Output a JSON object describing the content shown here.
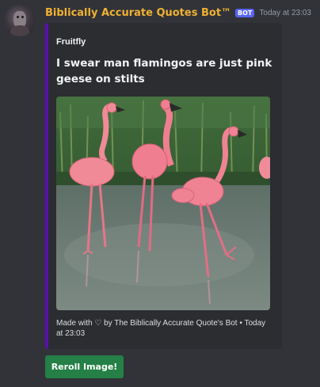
{
  "message": {
    "author": {
      "name": "Biblically Accurate Quotes Bot™",
      "tag": "BOT",
      "avatar_icon": "avatar"
    },
    "timestamp": "Today at 23:03",
    "embed": {
      "accent_color": "#5b0fb0",
      "author": "Fruitfly",
      "title": "I swear man flamingos are just pink geese on stilts",
      "image_icon": "ai-generated-flamingos-image",
      "footer": "Made with ♡ by The Biblically Accurate Quote's Bot • Today at 23:03"
    },
    "components": {
      "reroll_label": "Reroll Image!",
      "reroll_color": "#248046"
    }
  },
  "colors": {
    "background": "#313338",
    "embed_background": "#2b2d31",
    "username": "#f0b132",
    "bot_tag": "#5865f2",
    "timestamp": "#949ba4"
  }
}
